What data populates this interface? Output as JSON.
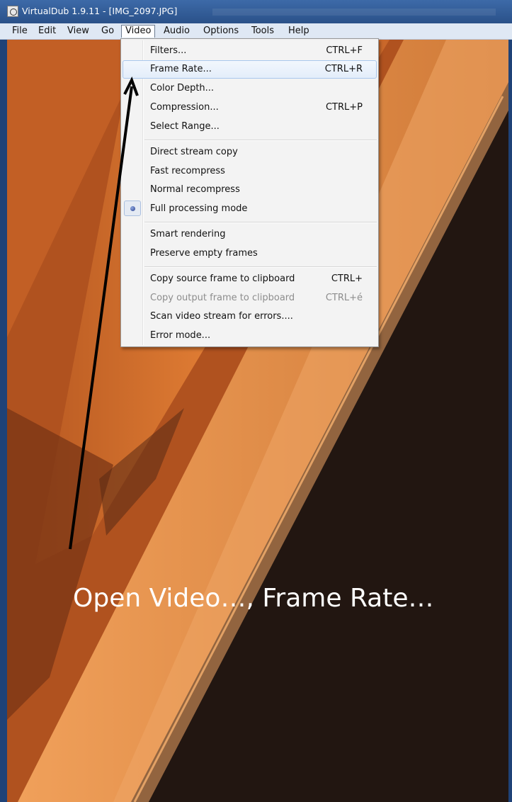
{
  "window": {
    "title": "VirtualDub 1.9.11 - [IMG_2097.JPG]"
  },
  "menubar": {
    "items": [
      "File",
      "Edit",
      "View",
      "Go",
      "Video",
      "Audio",
      "Options",
      "Tools",
      "Help"
    ],
    "active": "Video"
  },
  "video_menu": {
    "items": [
      {
        "label": "Filters...",
        "shortcut": "CTRL+F"
      },
      {
        "label": "Frame Rate...",
        "shortcut": "CTRL+R",
        "highlighted": true
      },
      {
        "label": "Color Depth..."
      },
      {
        "label": "Compression...",
        "shortcut": "CTRL+P"
      },
      {
        "label": "Select Range..."
      },
      {
        "label": "Direct stream copy"
      },
      {
        "label": "Fast recompress"
      },
      {
        "label": "Normal recompress"
      },
      {
        "label": "Full processing mode",
        "checked": true
      },
      {
        "label": "Smart rendering"
      },
      {
        "label": "Preserve empty frames"
      },
      {
        "label": "Copy source frame to clipboard",
        "shortcut": "CTRL+"
      },
      {
        "label": "Copy output frame to clipboard",
        "shortcut": "CTRL+é",
        "disabled": true
      },
      {
        "label": "Scan video stream for errors...."
      },
      {
        "label": "Error mode..."
      }
    ]
  },
  "annotation": {
    "caption": "Open Video…, Frame Rate…"
  },
  "colors": {
    "title_bar": "#2a5189",
    "menu_bar": "#dfe8f4",
    "photo_orange": "#d9742f",
    "photo_dark": "#211510",
    "arrow": "#000000"
  }
}
